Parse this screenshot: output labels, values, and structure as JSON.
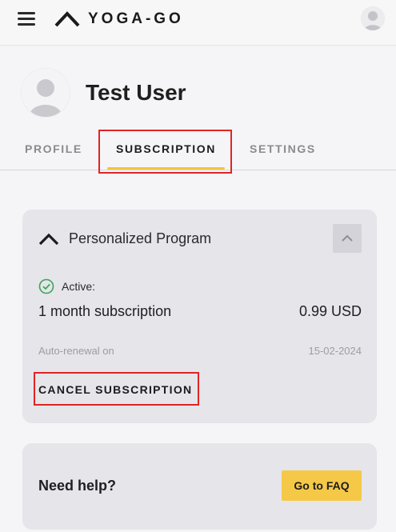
{
  "header": {
    "logo_text": "YOGA-GO",
    "menu_icon": "hamburger-menu-icon",
    "avatar_icon": "user-avatar-icon"
  },
  "profile": {
    "name": "Test User",
    "avatar_icon": "user-silhouette-icon"
  },
  "tabs": [
    {
      "label": "PROFILE",
      "active": false
    },
    {
      "label": "SUBSCRIPTION",
      "active": true
    },
    {
      "label": "SETTINGS",
      "active": false
    }
  ],
  "subscription": {
    "title": "Personalized Program",
    "status": "Active:",
    "status_icon": "check-circle-icon",
    "plan": "1 month subscription",
    "price": "0.99 USD",
    "renewal_label": "Auto-renewal on",
    "renewal_date": "15-02-2024",
    "cancel_label": "CANCEL SUBSCRIPTION"
  },
  "help": {
    "label": "Need help?",
    "faq_button": "Go to FAQ"
  },
  "colors": {
    "accent_yellow": "#f5c947",
    "tab_underline": "#f2c53d",
    "highlight_red": "#e02424",
    "status_green": "#3aa655",
    "card_bg": "#e5e5ea"
  }
}
